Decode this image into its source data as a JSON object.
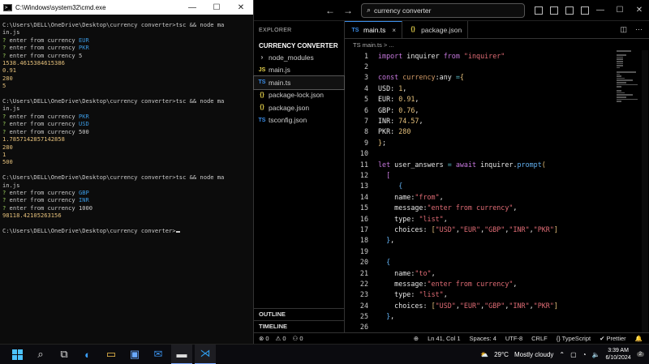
{
  "cmd": {
    "title": "C:\\Windows\\system32\\cmd.exe",
    "minimize": "—",
    "maximize": "☐",
    "close": "✕",
    "lines": [
      {
        "segments": [
          {
            "t": "C:\\Users\\DELL\\OneDrive\\Desktop\\currency converter>tsc && node ma",
            "c": ""
          }
        ]
      },
      {
        "segments": [
          {
            "t": "in.js",
            "c": ""
          }
        ]
      },
      {
        "segments": [
          {
            "t": "? ",
            "c": "g"
          },
          {
            "t": "enter from currency ",
            "c": ""
          },
          {
            "t": "EUR",
            "c": "c"
          }
        ]
      },
      {
        "segments": [
          {
            "t": "? ",
            "c": "g"
          },
          {
            "t": "enter from currency ",
            "c": ""
          },
          {
            "t": "PKR",
            "c": "c"
          }
        ]
      },
      {
        "segments": [
          {
            "t": "? ",
            "c": "g"
          },
          {
            "t": "enter from currency ",
            "c": ""
          },
          {
            "t": "5",
            "c": ""
          }
        ]
      },
      {
        "segments": [
          {
            "t": "1538.4615384615386",
            "c": "y"
          }
        ]
      },
      {
        "segments": [
          {
            "t": "0.91",
            "c": "y"
          }
        ]
      },
      {
        "segments": [
          {
            "t": "280",
            "c": "y"
          }
        ]
      },
      {
        "segments": [
          {
            "t": "5",
            "c": "y"
          }
        ]
      },
      {
        "segments": [
          {
            "t": "",
            "c": ""
          }
        ]
      },
      {
        "segments": [
          {
            "t": "C:\\Users\\DELL\\OneDrive\\Desktop\\currency converter>tsc && node ma",
            "c": ""
          }
        ]
      },
      {
        "segments": [
          {
            "t": "in.js",
            "c": ""
          }
        ]
      },
      {
        "segments": [
          {
            "t": "? ",
            "c": "g"
          },
          {
            "t": "enter from currency ",
            "c": ""
          },
          {
            "t": "PKR",
            "c": "c"
          }
        ]
      },
      {
        "segments": [
          {
            "t": "? ",
            "c": "g"
          },
          {
            "t": "enter from currency ",
            "c": ""
          },
          {
            "t": "USD",
            "c": "c"
          }
        ]
      },
      {
        "segments": [
          {
            "t": "? ",
            "c": "g"
          },
          {
            "t": "enter from currency ",
            "c": ""
          },
          {
            "t": "500",
            "c": ""
          }
        ]
      },
      {
        "segments": [
          {
            "t": "1.7857142857142858",
            "c": "y"
          }
        ]
      },
      {
        "segments": [
          {
            "t": "280",
            "c": "y"
          }
        ]
      },
      {
        "segments": [
          {
            "t": "1",
            "c": "y"
          }
        ]
      },
      {
        "segments": [
          {
            "t": "500",
            "c": "y"
          }
        ]
      },
      {
        "segments": [
          {
            "t": "",
            "c": ""
          }
        ]
      },
      {
        "segments": [
          {
            "t": "C:\\Users\\DELL\\OneDrive\\Desktop\\currency converter>tsc && node ma",
            "c": ""
          }
        ]
      },
      {
        "segments": [
          {
            "t": "in.js",
            "c": ""
          }
        ]
      },
      {
        "segments": [
          {
            "t": "? ",
            "c": "g"
          },
          {
            "t": "enter from currency ",
            "c": ""
          },
          {
            "t": "GBP",
            "c": "c"
          }
        ]
      },
      {
        "segments": [
          {
            "t": "? ",
            "c": "g"
          },
          {
            "t": "enter from currency ",
            "c": ""
          },
          {
            "t": "INR",
            "c": "c"
          }
        ]
      },
      {
        "segments": [
          {
            "t": "? ",
            "c": "g"
          },
          {
            "t": "enter from currency ",
            "c": ""
          },
          {
            "t": "1000",
            "c": ""
          }
        ]
      },
      {
        "segments": [
          {
            "t": "98118.42105263156",
            "c": "y"
          }
        ]
      },
      {
        "segments": [
          {
            "t": "",
            "c": ""
          }
        ]
      },
      {
        "segments": [
          {
            "t": "C:\\Users\\DELL\\OneDrive\\Desktop\\currency converter>",
            "c": ""
          }
        ]
      }
    ]
  },
  "vscode": {
    "back_arrow": "←",
    "forward_arrow": "→",
    "search": "currency converter",
    "win_min": "—",
    "win_max": "☐",
    "win_close": "✕",
    "explorer_title": "EXPLORER",
    "folder_name": "CURRENCY CONVERTER",
    "files": [
      {
        "name": "node_modules",
        "icon": "›",
        "kind": "chev",
        "active": false
      },
      {
        "name": "main.js",
        "icon": "JS",
        "kind": "js",
        "active": false
      },
      {
        "name": "main.ts",
        "icon": "TS",
        "kind": "ts",
        "active": true
      },
      {
        "name": "package-lock.json",
        "icon": "{}",
        "kind": "json",
        "active": false
      },
      {
        "name": "package.json",
        "icon": "{}",
        "kind": "json",
        "active": false
      },
      {
        "name": "tsconfig.json",
        "icon": "TS",
        "kind": "ts",
        "active": false
      }
    ],
    "outline_label": "OUTLINE",
    "timeline_label": "TIMELINE",
    "tabs": [
      {
        "label": "main.ts",
        "icon": "TS",
        "kind": "ts",
        "active": true,
        "close": "×"
      },
      {
        "label": "package.json",
        "icon": "{}",
        "kind": "json",
        "active": false,
        "close": ""
      }
    ],
    "breadcrumb": "TS  main.ts > ...",
    "code_lines": [
      {
        "n": "1",
        "parts": [
          {
            "t": "import ",
            "c": "kw"
          },
          {
            "t": "inquirer ",
            "c": "prop"
          },
          {
            "t": "from ",
            "c": "kw"
          },
          {
            "t": "\"inquirer\"",
            "c": "str"
          }
        ]
      },
      {
        "n": "2",
        "parts": []
      },
      {
        "n": "3",
        "parts": [
          {
            "t": "const ",
            "c": "kw"
          },
          {
            "t": "currency",
            "c": "var"
          },
          {
            "t": ":any ",
            "c": "prop"
          },
          {
            "t": "=",
            "c": "op"
          },
          {
            "t": "{",
            "c": "br1"
          }
        ]
      },
      {
        "n": "4",
        "parts": [
          {
            "t": "USD",
            "c": "prop"
          },
          {
            "t": ": ",
            "c": "prop"
          },
          {
            "t": "1",
            "c": "num"
          },
          {
            "t": ",",
            "c": "prop"
          }
        ]
      },
      {
        "n": "5",
        "parts": [
          {
            "t": "EUR",
            "c": "prop"
          },
          {
            "t": ": ",
            "c": "prop"
          },
          {
            "t": "0.91",
            "c": "num"
          },
          {
            "t": ",",
            "c": "prop"
          }
        ]
      },
      {
        "n": "6",
        "parts": [
          {
            "t": "GBP",
            "c": "prop"
          },
          {
            "t": ": ",
            "c": "prop"
          },
          {
            "t": "0.76",
            "c": "num"
          },
          {
            "t": ",",
            "c": "prop"
          }
        ]
      },
      {
        "n": "7",
        "parts": [
          {
            "t": "INR",
            "c": "prop"
          },
          {
            "t": ": ",
            "c": "prop"
          },
          {
            "t": "74.57",
            "c": "num"
          },
          {
            "t": ",",
            "c": "prop"
          }
        ]
      },
      {
        "n": "8",
        "parts": [
          {
            "t": "PKR",
            "c": "prop"
          },
          {
            "t": ": ",
            "c": "prop"
          },
          {
            "t": "280",
            "c": "num"
          }
        ]
      },
      {
        "n": "9",
        "parts": [
          {
            "t": "}",
            "c": "br1"
          },
          {
            "t": ";",
            "c": "prop"
          }
        ]
      },
      {
        "n": "10",
        "parts": []
      },
      {
        "n": "11",
        "parts": [
          {
            "t": "let ",
            "c": "kw"
          },
          {
            "t": "user_answers ",
            "c": "prop"
          },
          {
            "t": "= ",
            "c": "op"
          },
          {
            "t": "await ",
            "c": "kw"
          },
          {
            "t": "inquirer",
            "c": "prop"
          },
          {
            "t": ".",
            "c": "prop"
          },
          {
            "t": "prompt",
            "c": "fn"
          },
          {
            "t": "(",
            "c": "br1"
          }
        ]
      },
      {
        "n": "12",
        "parts": [
          {
            "t": "  [",
            "c": "br2"
          }
        ]
      },
      {
        "n": "13",
        "parts": [
          {
            "t": "     {",
            "c": "br3"
          }
        ]
      },
      {
        "n": "14",
        "parts": [
          {
            "t": "    name",
            "c": "prop"
          },
          {
            "t": ":",
            "c": "prop"
          },
          {
            "t": "\"from\"",
            "c": "str"
          },
          {
            "t": ",",
            "c": "prop"
          }
        ]
      },
      {
        "n": "15",
        "parts": [
          {
            "t": "    message",
            "c": "prop"
          },
          {
            "t": ":",
            "c": "prop"
          },
          {
            "t": "\"enter from currency\"",
            "c": "str"
          },
          {
            "t": ",",
            "c": "prop"
          }
        ]
      },
      {
        "n": "16",
        "parts": [
          {
            "t": "    type",
            "c": "prop"
          },
          {
            "t": ": ",
            "c": "prop"
          },
          {
            "t": "\"list\"",
            "c": "str"
          },
          {
            "t": ",",
            "c": "prop"
          }
        ]
      },
      {
        "n": "17",
        "parts": [
          {
            "t": "    choices",
            "c": "prop"
          },
          {
            "t": ": ",
            "c": "prop"
          },
          {
            "t": "[",
            "c": "br1"
          },
          {
            "t": "\"USD\"",
            "c": "str"
          },
          {
            "t": ",",
            "c": "prop"
          },
          {
            "t": "\"EUR\"",
            "c": "str"
          },
          {
            "t": ",",
            "c": "prop"
          },
          {
            "t": "\"GBP\"",
            "c": "str"
          },
          {
            "t": ",",
            "c": "prop"
          },
          {
            "t": "\"INR\"",
            "c": "str"
          },
          {
            "t": ",",
            "c": "prop"
          },
          {
            "t": "\"PKR\"",
            "c": "str"
          },
          {
            "t": "]",
            "c": "br1"
          }
        ]
      },
      {
        "n": "18",
        "parts": [
          {
            "t": "  }",
            "c": "br3"
          },
          {
            "t": ",",
            "c": "prop"
          }
        ]
      },
      {
        "n": "19",
        "parts": []
      },
      {
        "n": "20",
        "parts": [
          {
            "t": "  {",
            "c": "br3"
          }
        ]
      },
      {
        "n": "21",
        "parts": [
          {
            "t": "    name",
            "c": "prop"
          },
          {
            "t": ":",
            "c": "prop"
          },
          {
            "t": "\"to\"",
            "c": "str"
          },
          {
            "t": ",",
            "c": "prop"
          }
        ]
      },
      {
        "n": "22",
        "parts": [
          {
            "t": "    message",
            "c": "prop"
          },
          {
            "t": ":",
            "c": "prop"
          },
          {
            "t": "\"enter from currency\"",
            "c": "str"
          },
          {
            "t": ",",
            "c": "prop"
          }
        ]
      },
      {
        "n": "23",
        "parts": [
          {
            "t": "    type",
            "c": "prop"
          },
          {
            "t": ": ",
            "c": "prop"
          },
          {
            "t": "\"list\"",
            "c": "str"
          },
          {
            "t": ",",
            "c": "prop"
          }
        ]
      },
      {
        "n": "24",
        "parts": [
          {
            "t": "    choices",
            "c": "prop"
          },
          {
            "t": ": ",
            "c": "prop"
          },
          {
            "t": "[",
            "c": "br1"
          },
          {
            "t": "\"USD\"",
            "c": "str"
          },
          {
            "t": ",",
            "c": "prop"
          },
          {
            "t": "\"EUR\"",
            "c": "str"
          },
          {
            "t": ",",
            "c": "prop"
          },
          {
            "t": "\"GBP\"",
            "c": "str"
          },
          {
            "t": ",",
            "c": "prop"
          },
          {
            "t": "\"INR\"",
            "c": "str"
          },
          {
            "t": ",",
            "c": "prop"
          },
          {
            "t": "\"PKR\"",
            "c": "str"
          },
          {
            "t": "]",
            "c": "br1"
          }
        ]
      },
      {
        "n": "25",
        "parts": [
          {
            "t": "  }",
            "c": "br3"
          },
          {
            "t": ",",
            "c": "prop"
          }
        ]
      },
      {
        "n": "26",
        "parts": []
      }
    ],
    "status": {
      "errors": "⊗ 0",
      "warnings": "⚠ 0",
      "ports": "⚇ 0",
      "zoom": "⊕",
      "position": "Ln 41, Col 1",
      "spaces": "Spaces: 4",
      "encoding": "UTF-8",
      "eol": "CRLF",
      "language": "{} TypeScript",
      "prettier": "✔ Prettier",
      "bell": "🔔"
    }
  },
  "taskbar": {
    "weather": "29°C",
    "weather_desc": "Mostly cloudy",
    "time": "3:39 AM",
    "date": "6/10/2024",
    "badge": "2"
  }
}
